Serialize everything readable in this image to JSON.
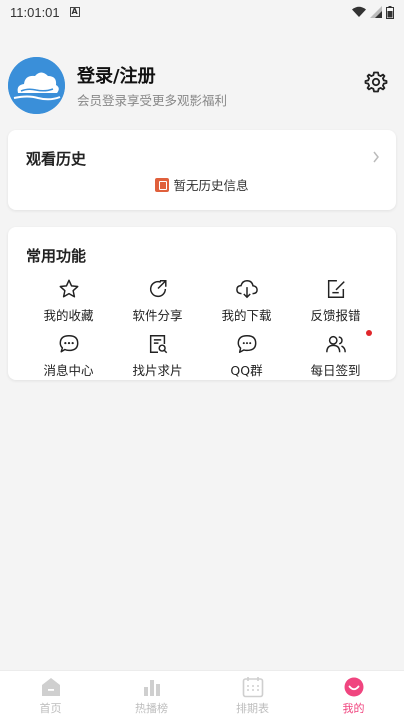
{
  "status_bar": {
    "time": "11:01:01",
    "badge": "A"
  },
  "profile": {
    "title": "登录/注册",
    "subtitle": "会员登录享受更多观影福利"
  },
  "history": {
    "title": "观看历史",
    "empty_text": "暂无历史信息"
  },
  "functions": {
    "title": "常用功能",
    "items": [
      {
        "label": "我的收藏",
        "icon": "star-icon"
      },
      {
        "label": "软件分享",
        "icon": "share-icon"
      },
      {
        "label": "我的下载",
        "icon": "cloud-download-icon"
      },
      {
        "label": "反馈报错",
        "icon": "feedback-edit-icon"
      },
      {
        "label": "消息中心",
        "icon": "message-icon"
      },
      {
        "label": "找片求片",
        "icon": "search-film-icon"
      },
      {
        "label": "QQ群",
        "icon": "chat-group-icon"
      },
      {
        "label": "每日签到",
        "icon": "users-icon"
      }
    ]
  },
  "bottom_nav": {
    "items": [
      {
        "label": "首页",
        "icon": "home-icon"
      },
      {
        "label": "热播榜",
        "icon": "ranking-icon"
      },
      {
        "label": "排期表",
        "icon": "calendar-icon"
      },
      {
        "label": "我的",
        "icon": "smile-icon"
      }
    ],
    "active_index": 3
  },
  "colors": {
    "accent": "#f0457f",
    "inactive": "#bdbdbd",
    "dot": "#e0262b",
    "avatar": "#3a8fd9"
  }
}
